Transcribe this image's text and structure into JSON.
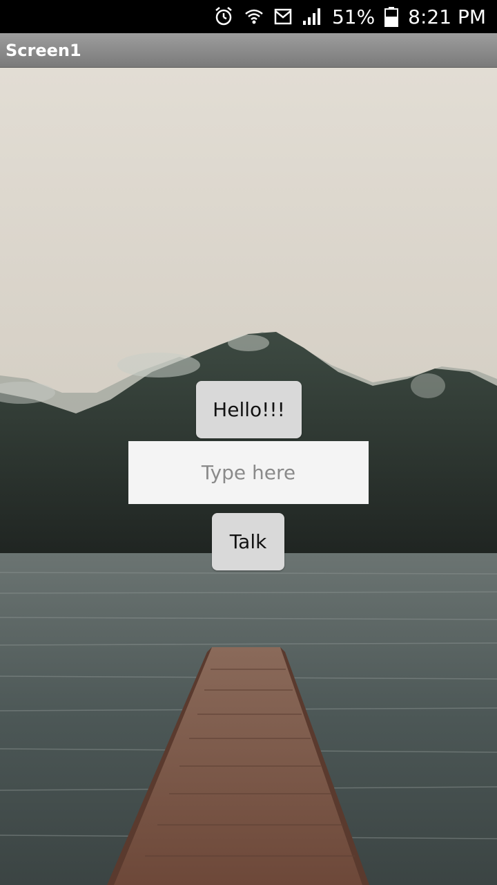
{
  "status_bar": {
    "battery": "51%",
    "time": "8:21 PM",
    "icons": [
      "alarm-icon",
      "wifi-icon",
      "message-icon",
      "signal-icon",
      "battery-icon"
    ]
  },
  "app": {
    "title": "Screen1"
  },
  "main": {
    "hello_button_label": "Hello!!!",
    "input_placeholder": "Type here",
    "talk_button_label": "Talk"
  },
  "colors": {
    "status_bar_bg": "#000000",
    "title_bar_bg": "#8c8c8c",
    "button_bg": "#d9d9d9",
    "input_bg": "#f4f4f4",
    "sky": "#dcd7cd",
    "water": "#4f5b5a",
    "dock": "#7a5544"
  }
}
